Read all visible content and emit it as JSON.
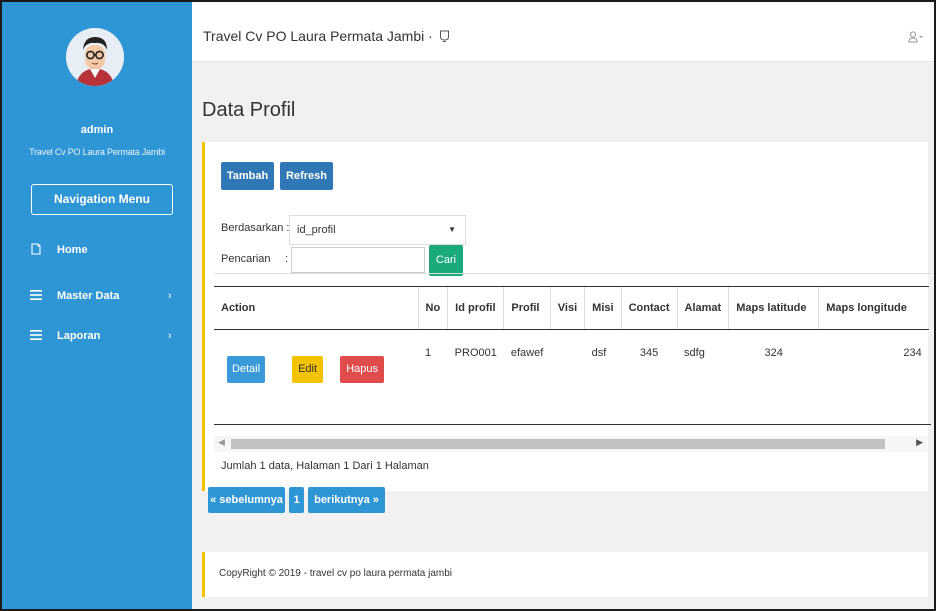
{
  "header": {
    "title": "Travel Cv PO Laura Permata Jambi ·",
    "bell_icon": "bell-icon",
    "user_icon": "user-dropdown-icon"
  },
  "sidebar": {
    "user_name": "admin",
    "org_name": "Travel Cv PO Laura Permata Jambi",
    "nav_button": "Navigation Menu",
    "items": [
      {
        "label": "Home",
        "icon": "home-icon"
      },
      {
        "label": "Master Data",
        "icon": "list-icon"
      },
      {
        "label": "Laporan",
        "icon": "list-icon"
      }
    ]
  },
  "main": {
    "page_title": "Data Profil",
    "toolbar": {
      "add_label": "Tambah",
      "refresh_label": "Refresh"
    },
    "filter": {
      "by_label": "Berdasarkan :",
      "by_value": "id_profil",
      "search_label": "Pencarian",
      "search_colon": ":",
      "search_value": "",
      "search_button": "Cari"
    },
    "table": {
      "headers": [
        "Action",
        "No",
        "Id profil",
        "Profil",
        "Visi",
        "Misi",
        "Contact",
        "Alamat",
        "Maps latitude",
        "Maps longitude"
      ],
      "rows": [
        {
          "actions": {
            "detail": "Detail",
            "edit": "Edit",
            "delete": "Hapus"
          },
          "no": "1",
          "id_profil": "PRO001",
          "profil": "efawef",
          "visi": "",
          "misi": "dsf",
          "contact": "345",
          "alamat": "sdfg",
          "maps_latitude": "324",
          "maps_longitude": "234"
        }
      ]
    },
    "summary": "Jumlah 1 data, Halaman 1 Dari 1 Halaman",
    "pagination": {
      "prev": "« sebelumnya",
      "current": "1",
      "next": "berikutnya »"
    }
  },
  "footer": {
    "text": "CopyRight © 2019 - travel cv po laura permata jambi"
  },
  "colors": {
    "sidebar": "#2f96d6",
    "accent_yellow": "#f3c300",
    "btn_blue": "#2f78b5",
    "btn_green": "#19a97b",
    "btn_detail": "#3a9ad9",
    "btn_edit": "#f3c300",
    "btn_delete": "#e04b4b"
  }
}
